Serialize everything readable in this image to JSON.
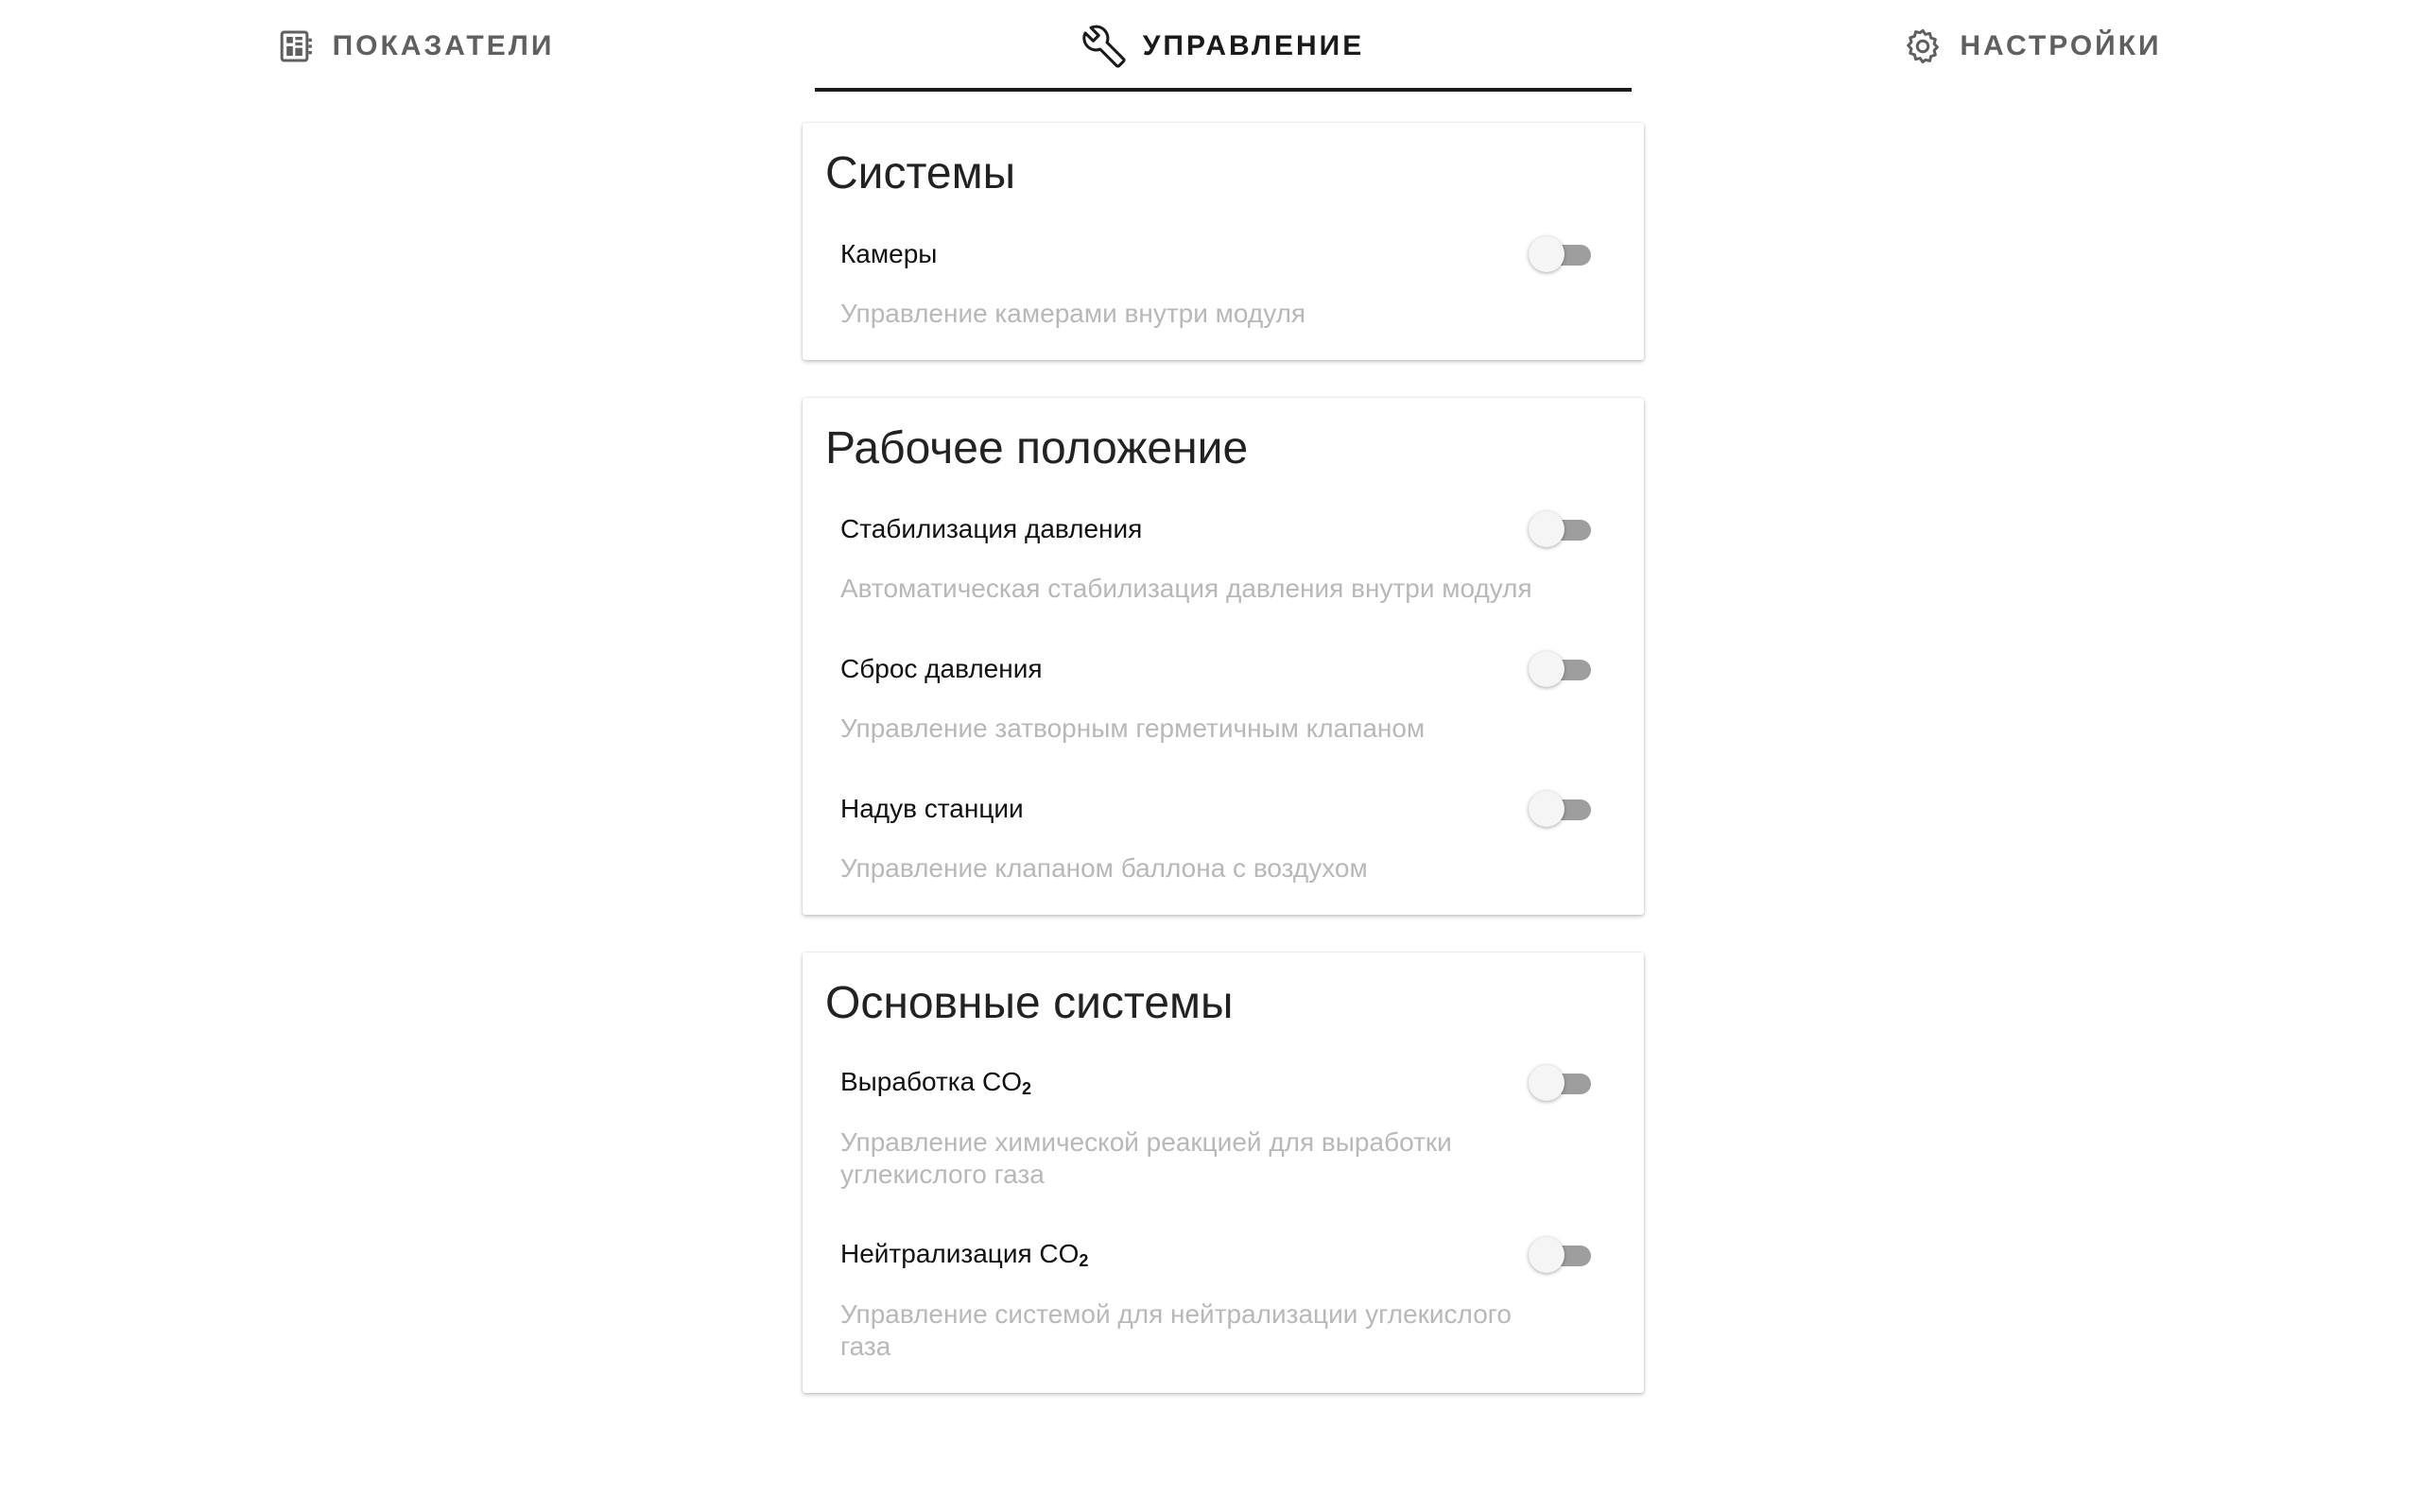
{
  "tabs": [
    {
      "label": "ПОКАЗАТЕЛИ",
      "icon": "dashboard-icon",
      "active": false
    },
    {
      "label": "УПРАВЛЕНИЕ",
      "icon": "wrench-icon",
      "active": true
    },
    {
      "label": "НАСТРОЙКИ",
      "icon": "gear-icon",
      "active": false
    }
  ],
  "colors": {
    "active_text": "#1a1a1a",
    "inactive_text": "#5f5f5f",
    "description": "#b8b8b8",
    "toggle_track_off": "#9e9e9e",
    "toggle_thumb_off": "#f5f5f5"
  },
  "cards": [
    {
      "title": "Системы",
      "items": [
        {
          "label": "Камеры",
          "description": "Управление камерами внутри модуля",
          "enabled": false
        }
      ]
    },
    {
      "title": "Рабочее положение",
      "items": [
        {
          "label": "Стабилизация давления",
          "description": "Автоматическая стабилизация давления внутри модуля",
          "enabled": false
        },
        {
          "label": "Сброс давления",
          "description": "Управление затворным герметичным клапаном",
          "enabled": false
        },
        {
          "label": "Надув станции",
          "description": "Управление клапаном баллона с воздухом",
          "enabled": false
        }
      ]
    },
    {
      "title": "Основные системы",
      "items": [
        {
          "label": "Выработка CO",
          "label_sub": "2",
          "description": "Управление химической реакцией для выработки углекислого газа",
          "enabled": false
        },
        {
          "label": "Нейтрализация CO",
          "label_sub": "2",
          "description": "Управление системой для нейтрализации углекислого газа",
          "enabled": false
        }
      ]
    }
  ]
}
